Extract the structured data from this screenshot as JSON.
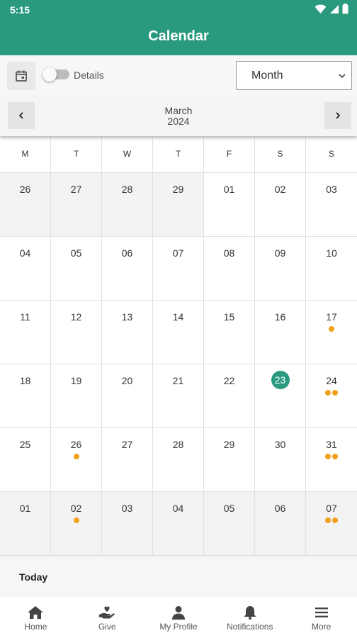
{
  "status_bar": {
    "time": "5:15"
  },
  "app_bar": {
    "title": "Calendar"
  },
  "toolbar": {
    "details_label": "Details",
    "view_selected": "Month"
  },
  "month_nav": {
    "month": "March",
    "year": "2024"
  },
  "weekdays": [
    "M",
    "T",
    "W",
    "T",
    "F",
    "S",
    "S"
  ],
  "days": [
    {
      "n": "26",
      "muted": true,
      "dots": 0
    },
    {
      "n": "27",
      "muted": true,
      "dots": 0
    },
    {
      "n": "28",
      "muted": true,
      "dots": 0
    },
    {
      "n": "29",
      "muted": true,
      "dots": 0
    },
    {
      "n": "01",
      "muted": false,
      "dots": 0
    },
    {
      "n": "02",
      "muted": false,
      "dots": 0
    },
    {
      "n": "03",
      "muted": false,
      "dots": 0
    },
    {
      "n": "04",
      "muted": false,
      "dots": 0
    },
    {
      "n": "05",
      "muted": false,
      "dots": 0
    },
    {
      "n": "06",
      "muted": false,
      "dots": 0
    },
    {
      "n": "07",
      "muted": false,
      "dots": 0
    },
    {
      "n": "08",
      "muted": false,
      "dots": 0
    },
    {
      "n": "09",
      "muted": false,
      "dots": 0
    },
    {
      "n": "10",
      "muted": false,
      "dots": 0
    },
    {
      "n": "11",
      "muted": false,
      "dots": 0
    },
    {
      "n": "12",
      "muted": false,
      "dots": 0
    },
    {
      "n": "13",
      "muted": false,
      "dots": 0
    },
    {
      "n": "14",
      "muted": false,
      "dots": 0
    },
    {
      "n": "15",
      "muted": false,
      "dots": 0
    },
    {
      "n": "16",
      "muted": false,
      "dots": 0
    },
    {
      "n": "17",
      "muted": false,
      "dots": 1
    },
    {
      "n": "18",
      "muted": false,
      "dots": 0
    },
    {
      "n": "19",
      "muted": false,
      "dots": 0
    },
    {
      "n": "20",
      "muted": false,
      "dots": 0
    },
    {
      "n": "21",
      "muted": false,
      "dots": 0
    },
    {
      "n": "22",
      "muted": false,
      "dots": 0
    },
    {
      "n": "23",
      "muted": false,
      "dots": 0,
      "selected": true
    },
    {
      "n": "24",
      "muted": false,
      "dots": 2
    },
    {
      "n": "25",
      "muted": false,
      "dots": 0
    },
    {
      "n": "26",
      "muted": false,
      "dots": 1
    },
    {
      "n": "27",
      "muted": false,
      "dots": 0
    },
    {
      "n": "28",
      "muted": false,
      "dots": 0
    },
    {
      "n": "29",
      "muted": false,
      "dots": 0
    },
    {
      "n": "30",
      "muted": false,
      "dots": 0
    },
    {
      "n": "31",
      "muted": false,
      "dots": 2
    },
    {
      "n": "01",
      "muted": true,
      "dots": 0
    },
    {
      "n": "02",
      "muted": true,
      "dots": 1
    },
    {
      "n": "03",
      "muted": true,
      "dots": 0
    },
    {
      "n": "04",
      "muted": true,
      "dots": 0
    },
    {
      "n": "05",
      "muted": true,
      "dots": 0
    },
    {
      "n": "06",
      "muted": true,
      "dots": 0
    },
    {
      "n": "07",
      "muted": true,
      "dots": 2
    }
  ],
  "today_label": "Today",
  "bottom_nav": [
    {
      "label": "Home",
      "icon": "home-icon"
    },
    {
      "label": "Give",
      "icon": "give-hand-heart-icon"
    },
    {
      "label": "My Profile",
      "icon": "person-icon"
    },
    {
      "label": "Notifications",
      "icon": "bell-icon"
    },
    {
      "label": "More",
      "icon": "menu-icon"
    }
  ],
  "colors": {
    "primary": "#2a9a7f",
    "event_dot": "#f1a01a"
  }
}
